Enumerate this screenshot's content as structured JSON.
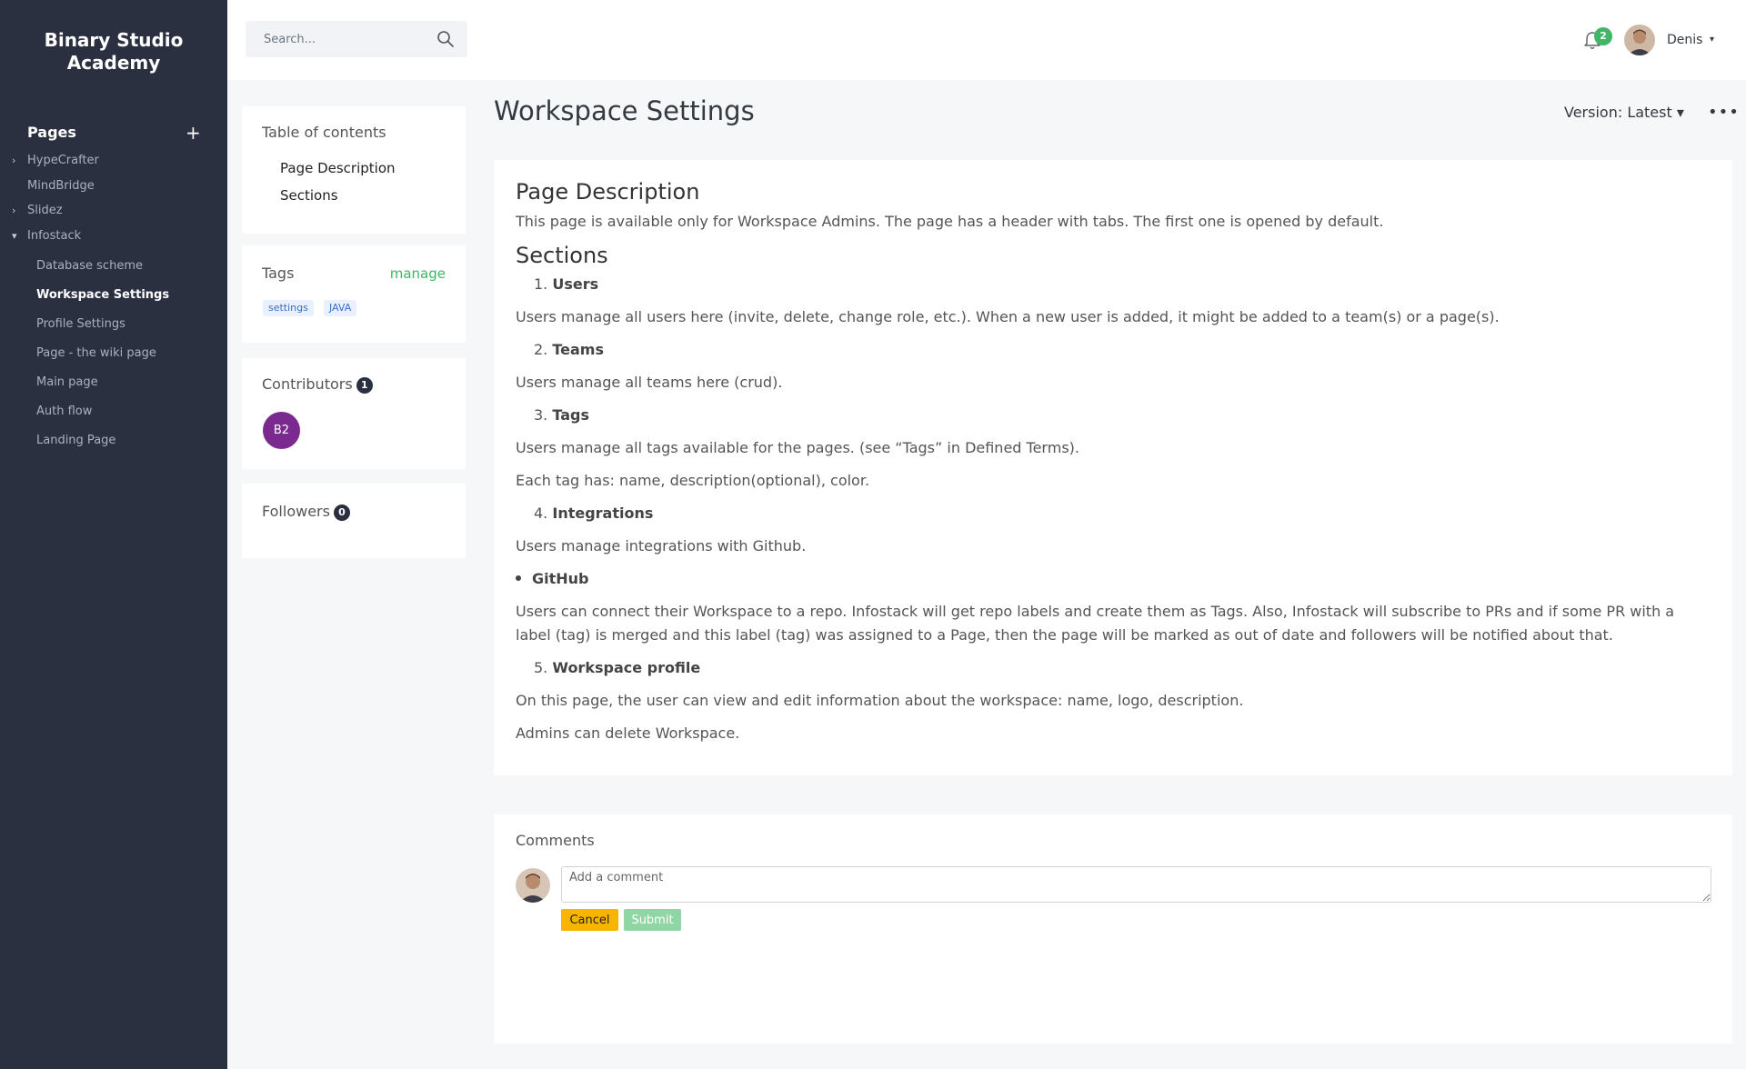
{
  "brand": {
    "line1": "Binary Studio",
    "line2": "Academy"
  },
  "sidebar": {
    "pages_title": "Pages",
    "add_symbol": "+",
    "items": [
      {
        "label": "HypeCrafter",
        "caret": "›"
      },
      {
        "label": "MindBridge",
        "caret": ""
      },
      {
        "label": "Slidez",
        "caret": "›"
      },
      {
        "label": "Infostack",
        "caret": "▾"
      }
    ],
    "children": [
      {
        "label": "Database scheme"
      },
      {
        "label": "Workspace Settings"
      },
      {
        "label": "Profile Settings"
      },
      {
        "label": "Page - the wiki page"
      },
      {
        "label": "Main page"
      },
      {
        "label": "Auth flow"
      },
      {
        "label": "Landing Page"
      }
    ]
  },
  "topbar": {
    "search_placeholder": "Search...",
    "notifications_count": "2",
    "user_name": "Denis",
    "user_caret": "▾"
  },
  "toc": {
    "title": "Table of contents",
    "links": [
      "Page Description",
      "Sections"
    ]
  },
  "tags": {
    "title": "Tags",
    "manage": "manage",
    "items": [
      "settings",
      "JAVA"
    ]
  },
  "contributors": {
    "title": "Contributors",
    "count": "1",
    "avatar_initials": "B2"
  },
  "followers": {
    "title": "Followers",
    "count": "0"
  },
  "page": {
    "title": "Workspace Settings",
    "version": "Version: Latest ▾",
    "more": "•••"
  },
  "content": {
    "h1": "Page Description",
    "p1": "This page is available only for Workspace Admins. The page has a header with tabs. The first one is opened by default.",
    "h2": "Sections",
    "s1_num": "1.",
    "s1_title": "Users",
    "s1_text": "Users manage all users here (invite, delete, change role, etc.). When a new user is added, it might be added to a team(s) or a page(s).",
    "s2_num": "2.",
    "s2_title": "Teams",
    "s2_text": "Users manage all teams here (crud).",
    "s3_num": "3.",
    "s3_title": "Tags",
    "s3_text1": "Users manage all tags available for the pages. (see “Tags” in Defined Terms).",
    "s3_text2": "Each tag has: name, description(optional), color.",
    "s4_num": "4.",
    "s4_title": "Integrations",
    "s4_text": "Users manage integrations with Github.",
    "bullet": "GitHub",
    "github_text": "Users can connect their Workspace to a repo. Infostack will get repo labels and create them as Tags. Also, Infostack will subscribe to PRs and if some PR with a label (tag) is merged and this label (tag) was assigned to a Page, then the page will be marked as out of date and followers will be notified about that.",
    "s5_num": "5.",
    "s5_title": "Workspace profile",
    "s5_text1": "On this page, the user can view and edit information about the workspace: name, logo, description.",
    "s5_text2": "Admins can delete Workspace."
  },
  "comments": {
    "title": "Comments",
    "placeholder": "Add a comment",
    "cancel": "Cancel",
    "submit": "Submit"
  },
  "colors": {
    "sidebar_bg": "#2b3040",
    "accent_green": "#3fb668",
    "cancel_yellow": "#f7b500",
    "submit_green_disabled": "#8fd6a4",
    "contributor_purple": "#7a2a8f"
  },
  "icons": [
    "search-icon",
    "bell-icon",
    "user-avatar",
    "plus-icon",
    "chevron-right-icon",
    "caret-down-icon",
    "more-icon"
  ]
}
